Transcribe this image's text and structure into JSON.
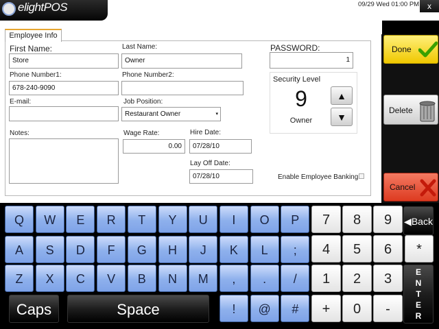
{
  "app": {
    "logo_text": "elightPOS",
    "datetime": "09/29 Wed 01:00 PM",
    "close_label": "x"
  },
  "tab": {
    "label": "Employee Info"
  },
  "form": {
    "first_name": {
      "label": "First Name:",
      "value": "Store"
    },
    "last_name": {
      "label": "Last Name:",
      "value": "Owner"
    },
    "password": {
      "label": "PASSWORD:",
      "value": "1"
    },
    "phone1": {
      "label": "Phone Number1:",
      "value": "678-240-9090"
    },
    "phone2": {
      "label": "Phone Number2:",
      "value": ""
    },
    "email": {
      "label": "E-mail:",
      "value": ""
    },
    "job_position": {
      "label": "Job Position:",
      "value": "Restaurant Owner"
    },
    "notes": {
      "label": "Notes:",
      "value": ""
    },
    "wage_rate": {
      "label": "Wage Rate:",
      "value": "0.00"
    },
    "hire_date": {
      "label": "Hire Date:",
      "value": "07/28/10"
    },
    "layoff_date": {
      "label": "Lay Off Date:",
      "value": "07/28/10"
    },
    "security": {
      "label": "Security Level",
      "level": "9",
      "role": "Owner",
      "up_icon": "▲",
      "down_icon": "▼"
    },
    "banking": {
      "label": "Enable Employee Banking",
      "checked": false
    }
  },
  "actions": {
    "done": "Done",
    "delete": "Delete",
    "cancel": "Cancel"
  },
  "keyboard": {
    "row1": [
      "Q",
      "W",
      "E",
      "R",
      "T",
      "Y",
      "U",
      "I",
      "O",
      "P"
    ],
    "row2": [
      "A",
      "S",
      "D",
      "F",
      "G",
      "H",
      "J",
      "K",
      "L",
      ";"
    ],
    "row3": [
      "Z",
      "X",
      "C",
      "V",
      "B",
      "N",
      "M",
      ",",
      ".",
      "/"
    ],
    "row4": [
      "!",
      "@",
      "#"
    ],
    "num_row1": [
      "7",
      "8",
      "9"
    ],
    "num_row2": [
      "4",
      "5",
      "6"
    ],
    "num_row3": [
      "1",
      "2",
      "3"
    ],
    "num_row4": [
      "+",
      "0",
      "-"
    ],
    "back": "Back",
    "star": "*",
    "caps": "Caps",
    "space": "Space",
    "enter_letters": [
      "E",
      "N",
      "T",
      "E",
      "R"
    ]
  },
  "colors": {
    "key_blue": "#8eb0ec",
    "done_yellow": "#f0c800",
    "cancel_red": "#dd3a20",
    "tab_accent": "#e6a630"
  }
}
